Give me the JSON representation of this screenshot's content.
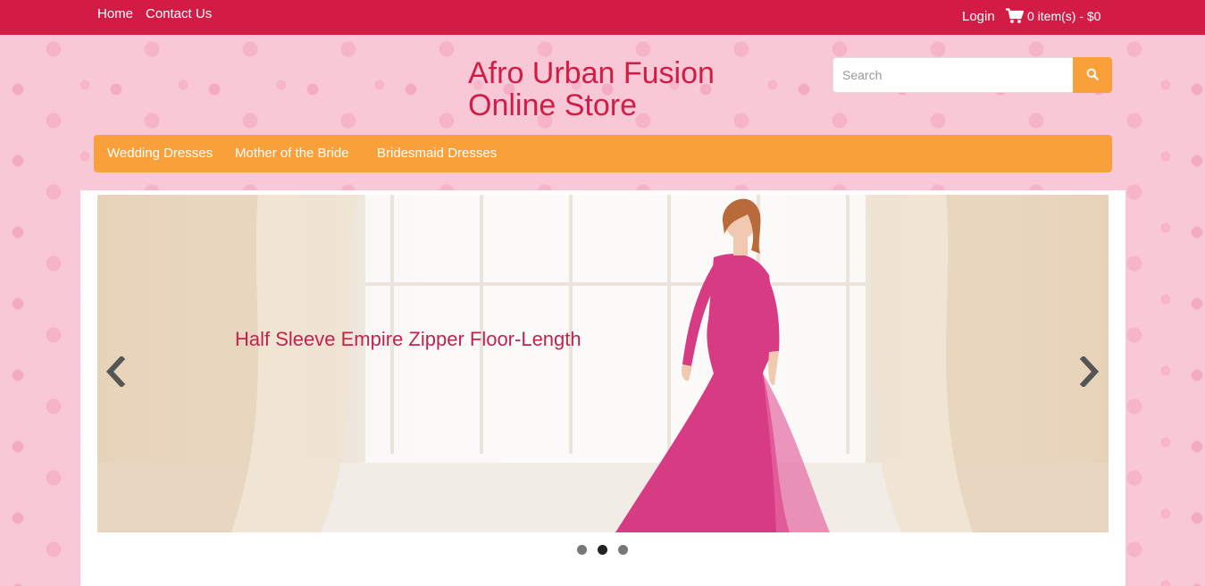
{
  "topbar": {
    "links": [
      "Home",
      "Contact Us"
    ],
    "login_label": "Login",
    "cart_label": "0 item(s) - $0"
  },
  "logo": {
    "line1": "Afro Urban Fusion",
    "line2": "Online Store"
  },
  "search": {
    "placeholder": "Search"
  },
  "categories": [
    "Wedding Dresses",
    "Mother of the Bride",
    "Bridesmaid Dresses"
  ],
  "carousel": {
    "caption": "Half Sleeve Empire Zipper Floor-Length",
    "indicator_count": 3,
    "active_index": 1
  },
  "colors": {
    "brand_red": "#d21c46",
    "accent_orange": "#f9a03a",
    "background_pink": "#f8c8d6",
    "dress_pink": "#d63b84"
  },
  "icons": {
    "cart": "shopping-cart-icon",
    "search": "search-icon",
    "prev": "chevron-left-icon",
    "next": "chevron-right-icon"
  }
}
